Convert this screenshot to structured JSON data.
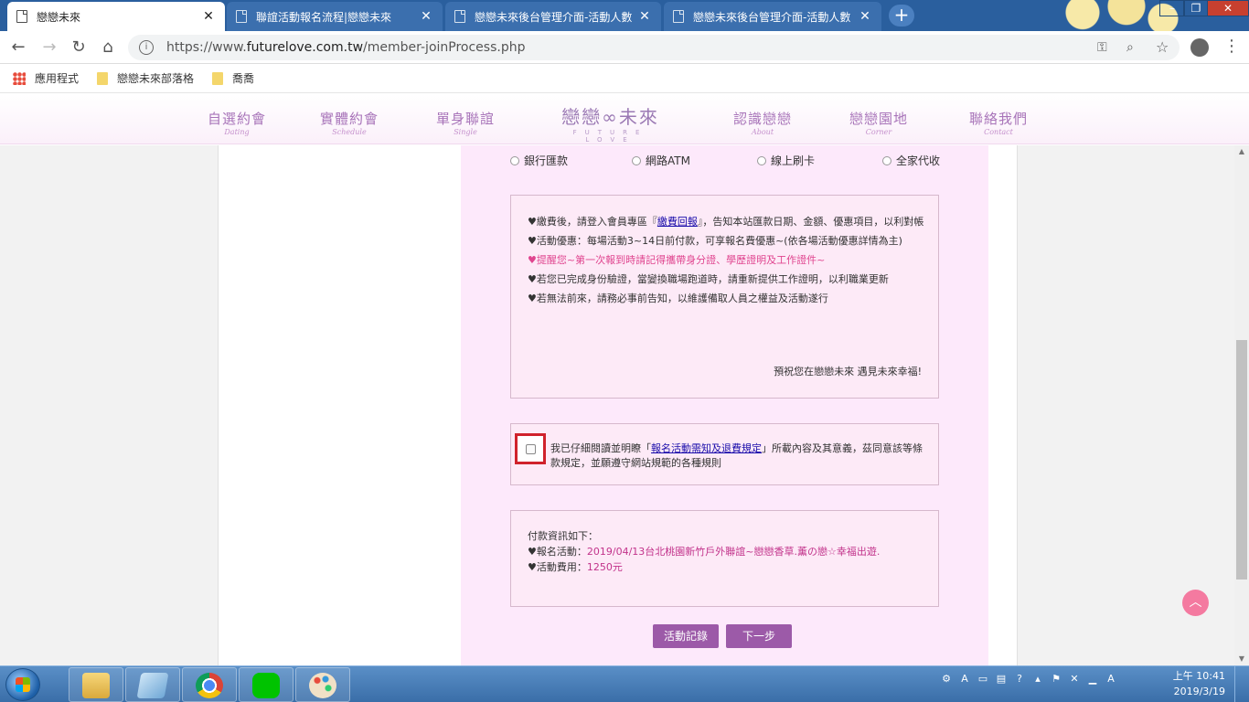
{
  "browser": {
    "tabs": [
      {
        "title": "戀戀未來",
        "active": true
      },
      {
        "title": "聯誼活動報名流程|戀戀未來",
        "active": false
      },
      {
        "title": "戀戀未來後台管理介面-活動人數",
        "active": false
      },
      {
        "title": "戀戀未來後台管理介面-活動人數",
        "active": false
      }
    ],
    "tab_close_glyph": "✕",
    "new_tab_glyph": "+",
    "url_prefix": "https://www.",
    "url_host": "futurelove.com.tw",
    "url_path": "/member-joinProcess.php",
    "bookmarks": [
      "應用程式",
      "戀戀未來部落格",
      "喬喬"
    ]
  },
  "site": {
    "nav": [
      {
        "zh": "自選約會",
        "en": "Dating"
      },
      {
        "zh": "實體約會",
        "en": "Schedule"
      },
      {
        "zh": "單身聯誼",
        "en": "Single"
      },
      {
        "zh": "認識戀戀",
        "en": "About"
      },
      {
        "zh": "戀戀園地",
        "en": "Corner"
      },
      {
        "zh": "聯絡我們",
        "en": "Contact"
      }
    ],
    "logo_main": "戀戀∞未來",
    "logo_sub": "FUTURE LOVE"
  },
  "payment_options": [
    "銀行匯款",
    "網路ATM",
    "線上刷卡",
    "全家代收"
  ],
  "notice": {
    "line1_pre": "♥繳費後，請登入會員專區『",
    "line1_link": "繳費回報",
    "line1_post": "』，告知本站匯款日期、金額、優惠項目，以利對帳",
    "line2": "♥活動優惠：每場活動3~14日前付款，可享報名費優惠~(依各場活動優惠詳情為主)",
    "line3": "♥提醒您~第一次報到時請記得攜帶身分證、學歷證明及工作證件~",
    "line4": "♥若您已完成身份驗證，當變換職場跑道時，請重新提供工作證明，以利職業更新",
    "line5": "♥若無法前來，請務必事前告知，以維護備取人員之權益及活動遂行",
    "blessing": "預祝您在戀戀未來 遇見未來幸福!"
  },
  "agreement": {
    "pre": "我已仔細閱讀並明瞭「",
    "link": "報名活動需知及退費規定",
    "post": "」所載內容及其意義，茲同意該等條款規定，並願遵守網站規範的各種規則"
  },
  "payment_info": {
    "heading": "付款資訊如下：",
    "event_label": "♥報名活動：",
    "event_value": "2019/04/13台北桃園新竹戶外聯誼~戀戀香草.薰の戀☆幸福出遊.",
    "fee_label": "♥活動費用：",
    "fee_value": "1250元"
  },
  "buttons": {
    "history": "活動記錄",
    "next": "下一步"
  },
  "scroll_top_glyph": "︿",
  "taskbar": {
    "time": "上午 10:41",
    "date": "2019/3/19"
  },
  "colors": {
    "accent_purple": "#9c5aa8",
    "pink_text": "#e0458f",
    "highlight_red": "#d0222c"
  }
}
